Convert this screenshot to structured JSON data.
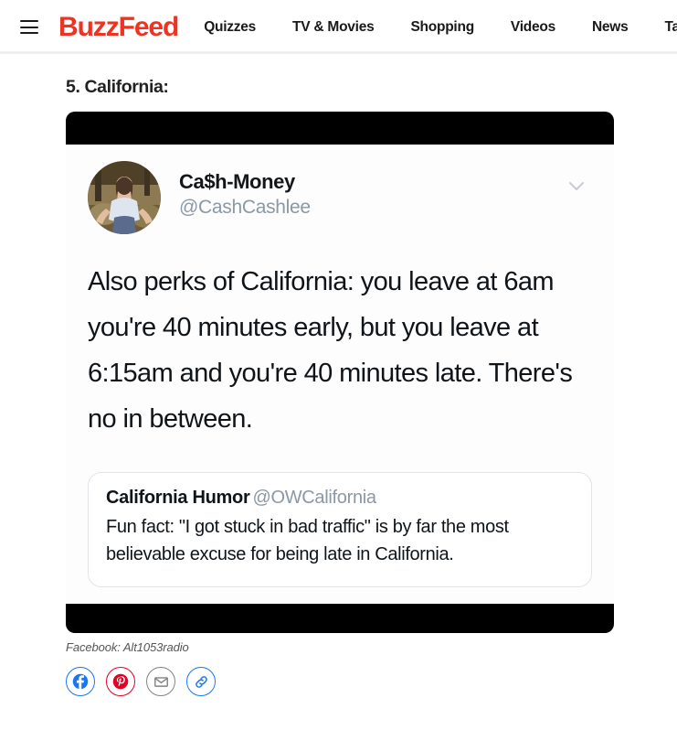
{
  "header": {
    "menu_icon": "hamburger-menu-icon",
    "brand": "BuzzFeed",
    "brand_color": "#ee3322",
    "nav": [
      {
        "label": "Quizzes"
      },
      {
        "label": "TV & Movies"
      },
      {
        "label": "Shopping"
      },
      {
        "label": "Videos"
      },
      {
        "label": "News"
      },
      {
        "label": "Tasty"
      }
    ]
  },
  "article": {
    "entry_title": "5. California:",
    "caption": "Facebook: Alt1053radio"
  },
  "tweet": {
    "display_name": "Ca$h-Money",
    "handle": "@CashCashlee",
    "avatar_alt": "profile-photo",
    "more_icon": "chevron-down-icon",
    "text": "Also perks of California: you leave at 6am you're 40 minutes early, but you leave at 6:15am and you're 40 minutes late. There's no in between.",
    "quote": {
      "display_name": "California Humor",
      "handle": "@OWCalifornia",
      "text": "Fun fact: \"I got stuck in bad traffic\" is by far the most believable excuse for being late in California."
    }
  },
  "share": {
    "buttons": [
      {
        "name": "facebook",
        "label": "Facebook",
        "color": "#1877f2"
      },
      {
        "name": "pinterest",
        "label": "Pinterest",
        "color": "#e60023"
      },
      {
        "name": "email",
        "label": "Email",
        "color": "#828282"
      },
      {
        "name": "link",
        "label": "Copy link",
        "color": "#1877f2"
      }
    ]
  }
}
